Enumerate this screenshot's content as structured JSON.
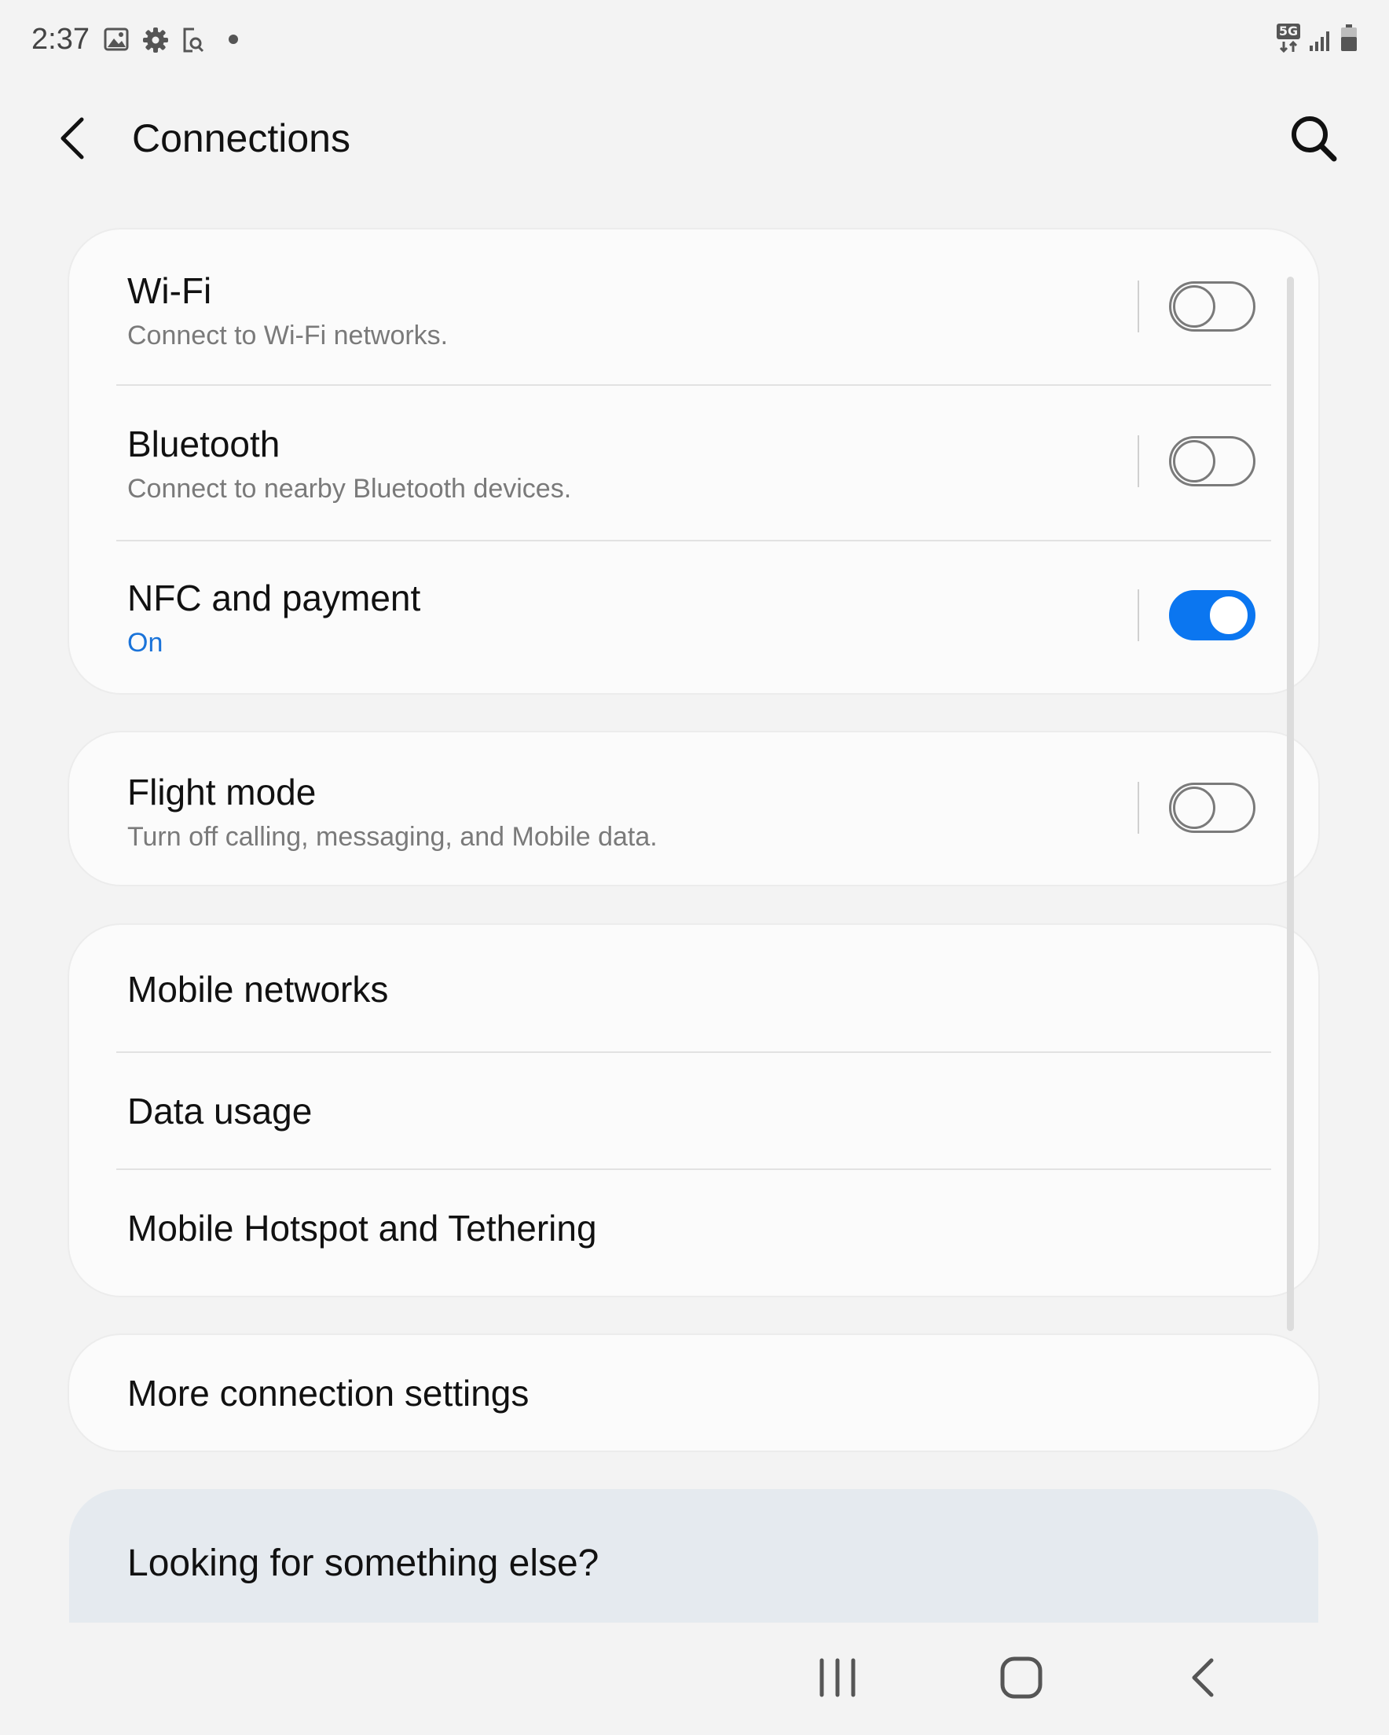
{
  "status_bar": {
    "time": "2:37",
    "left_icons": [
      "image-icon",
      "gear-icon",
      "screen-search-icon",
      "dot-icon"
    ],
    "right_icons": [
      "5g-icon",
      "signal-icon",
      "battery-icon"
    ],
    "network_label": "5G"
  },
  "header": {
    "title": "Connections",
    "back_icon": "chevron-left-icon",
    "search_icon": "search-icon"
  },
  "groups": {
    "wireless": [
      {
        "title": "Wi-Fi",
        "subtitle": "Connect to Wi-Fi networks.",
        "toggle": false
      },
      {
        "title": "Bluetooth",
        "subtitle": "Connect to nearby Bluetooth devices.",
        "toggle": false
      },
      {
        "title": "NFC and payment",
        "subtitle": "On",
        "toggle": true
      }
    ],
    "flight": [
      {
        "title": "Flight mode",
        "subtitle": "Turn off calling, messaging, and Mobile data.",
        "toggle": false
      }
    ],
    "mobile": [
      {
        "title": "Mobile networks"
      },
      {
        "title": "Data usage"
      },
      {
        "title": "Mobile Hotspot and Tethering"
      }
    ],
    "more": [
      {
        "title": "More connection settings"
      }
    ]
  },
  "suggestion": {
    "title": "Looking for something else?"
  },
  "nav_bar": {
    "recents_icon": "recents-icon",
    "home_icon": "home-icon",
    "back_icon": "back-icon"
  },
  "colors": {
    "background": "#f3f3f3",
    "card": "#fbfbfb",
    "accent": "#0b76f0",
    "subtitle": "#7a7a7a",
    "suggestion_card": "#e5eaef"
  }
}
